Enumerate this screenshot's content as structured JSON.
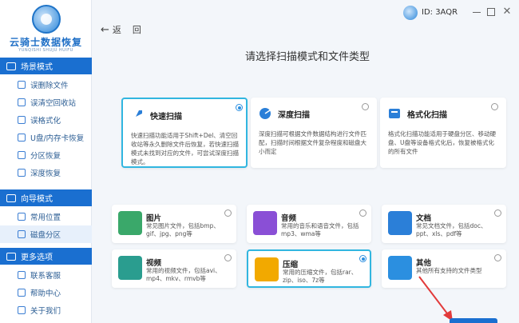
{
  "app": {
    "name": "云骑士数据恢复",
    "subtitle": "YUNQISHI SHUJU HUIFU"
  },
  "user": {
    "id_text": "ID: 3AQR"
  },
  "sidebar": {
    "sections": [
      {
        "label": "场景模式",
        "items": [
          "误删除文件",
          "误清空回收站",
          "误格式化",
          "U盘/内存卡恢复",
          "分区恢复",
          "深度恢复"
        ]
      },
      {
        "label": "向导模式",
        "items": [
          "常用位置",
          "磁盘分区"
        ]
      },
      {
        "label": "更多选项",
        "items": [
          "联系客服",
          "帮助中心",
          "关于我们"
        ]
      }
    ]
  },
  "nav": {
    "back": "返",
    "back2": "回"
  },
  "main": {
    "title": "请选择扫描模式和文件类型",
    "modes": [
      {
        "title": "快速扫描",
        "desc": "快速扫描功能适用于Shift+Del、清空回收站等永久删除文件后恢复，若快速扫描模式未找到对应的文件，可尝试深度扫描模式。"
      },
      {
        "title": "深度扫描",
        "desc": "深度扫描可根据文件数据结构进行文件匹配，扫描时间根据文件复杂程度和磁盘大小而定"
      },
      {
        "title": "格式化扫描",
        "desc": "格式化扫描功能适用于硬盘分区、移动硬盘、U盘等设备格式化后，恢复被格式化的所有文件"
      }
    ],
    "types": [
      {
        "title": "图片",
        "desc": "常见图片文件，包括bmp、gif、jpg、png等"
      },
      {
        "title": "音频",
        "desc": "常用的音乐和语音文件，包括mp3、wma等"
      },
      {
        "title": "文档",
        "desc": "常见文档文件，包括doc、ppt、xls、pdf等"
      },
      {
        "title": "视频",
        "desc": "常用的视频文件，包括avi、mp4、mkv、rmvb等"
      },
      {
        "title": "压缩",
        "desc": "常用的压缩文件，包括rar、zip、iso、7z等"
      },
      {
        "title": "其他",
        "desc": "其他所有支持的文件类型"
      }
    ]
  },
  "colors": {
    "accent": "#1a6fd0",
    "highlight": "#31b6e0",
    "arrow": "#e23a3a"
  }
}
